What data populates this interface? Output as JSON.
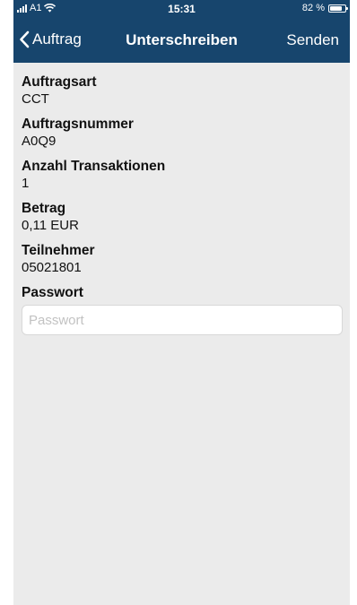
{
  "status_bar": {
    "carrier": "A1",
    "time": "15:31",
    "battery_text": "82 %",
    "battery_level": 0.82
  },
  "nav": {
    "back_label": "Auftrag",
    "title": "Unterschreiben",
    "send_label": "Senden"
  },
  "fields": [
    {
      "label": "Auftragsart",
      "value": "CCT"
    },
    {
      "label": "Auftragsnummer",
      "value": "A0Q9"
    },
    {
      "label": "Anzahl Transaktionen",
      "value": "1"
    },
    {
      "label": "Betrag",
      "value": "0,11 EUR"
    },
    {
      "label": "Teilnehmer",
      "value": "05021801"
    }
  ],
  "password": {
    "label": "Passwort",
    "placeholder": "Passwort",
    "value": ""
  },
  "colors": {
    "nav_background": "#17456d",
    "content_background": "#ebebeb"
  },
  "icons": {
    "back": "chevron-left-icon",
    "signal": "signal-bars-icon",
    "wifi": "wifi-icon",
    "battery": "battery-icon"
  }
}
